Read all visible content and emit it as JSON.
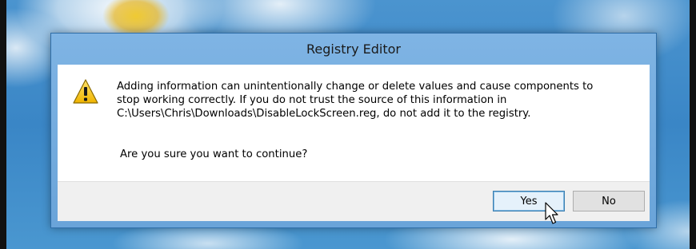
{
  "dialog": {
    "title": "Registry Editor",
    "icon": "warning-icon",
    "message_lines": [
      "Adding information can unintentionally change or delete values and cause components to",
      "stop working correctly. If you do not trust the source of this information in",
      "C:\\Users\\Chris\\Downloads\\DisableLockScreen.reg, do not add it to the registry."
    ],
    "question": "Are you sure you want to continue?",
    "buttons": {
      "yes_label": "Yes",
      "no_label": "No"
    }
  },
  "colors": {
    "frame": "#6aa4d9",
    "yes_button_border": "#3c7fb1",
    "warning_yellow": "#f5c518"
  },
  "cursor": "arrow-cursor-icon"
}
